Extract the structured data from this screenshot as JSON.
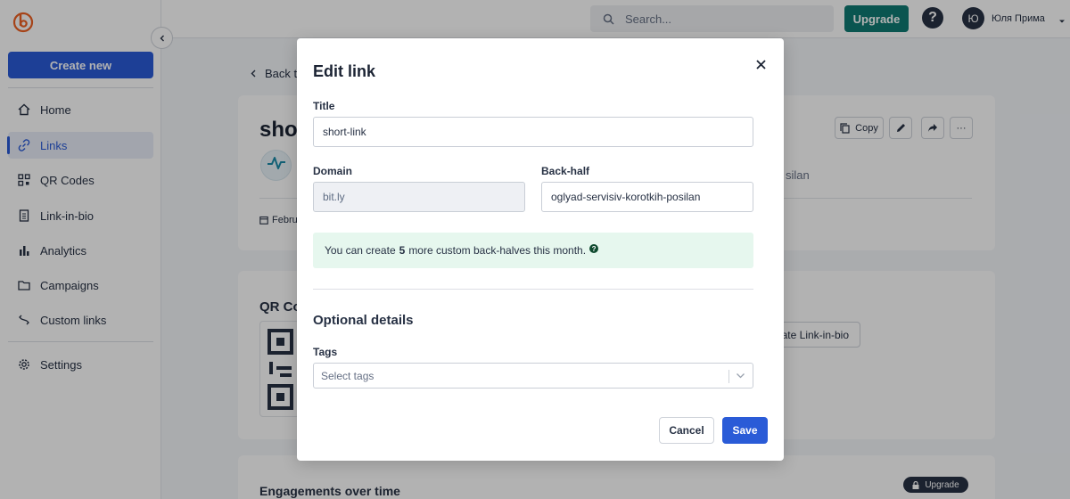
{
  "sidebar": {
    "create_label": "Create new",
    "nav": [
      {
        "label": "Home",
        "icon": "home-icon"
      },
      {
        "label": "Links",
        "icon": "link-icon",
        "active": true
      },
      {
        "label": "QR Codes",
        "icon": "qr-code-icon"
      },
      {
        "label": "Link-in-bio",
        "icon": "page-icon"
      },
      {
        "label": "Analytics",
        "icon": "bar-chart-icon"
      },
      {
        "label": "Campaigns",
        "icon": "folder-icon"
      },
      {
        "label": "Custom links",
        "icon": "custom-link-icon"
      },
      {
        "label": "Settings",
        "icon": "gear-icon"
      }
    ]
  },
  "topbar": {
    "search_placeholder": "Search...",
    "upgrade_label": "Upgrade",
    "help_label": "?",
    "avatar_initials": "Ю",
    "user_name": "Юля Прима"
  },
  "page": {
    "back_label": "Back to",
    "title": "sho",
    "copy_label": "Copy",
    "slug_tail": "silan",
    "date": "Febru",
    "qr_title": "QR Co",
    "link_in_bio_button": "ate Link-in-bio",
    "engagements_title": "Engagements over time",
    "upgrade_pill": "Upgrade"
  },
  "modal": {
    "title": "Edit link",
    "title_label": "Title",
    "title_value": "short-link",
    "domain_label": "Domain",
    "domain_value": "bit.ly",
    "backhalf_label": "Back-half",
    "backhalf_value": "oglyad-servisiv-korotkih-posilan",
    "notice_prefix": "You can create",
    "notice_count": "5",
    "notice_suffix": "more custom back-halves this month.",
    "optional_title": "Optional details",
    "tags_label": "Tags",
    "tags_placeholder": "Select tags",
    "cancel_label": "Cancel",
    "save_label": "Save"
  },
  "colors": {
    "primary": "#2a5bd7",
    "upgrade": "#0f7a73",
    "brand_logo": "#ee6123",
    "notice_bg": "#e6f7ee"
  }
}
